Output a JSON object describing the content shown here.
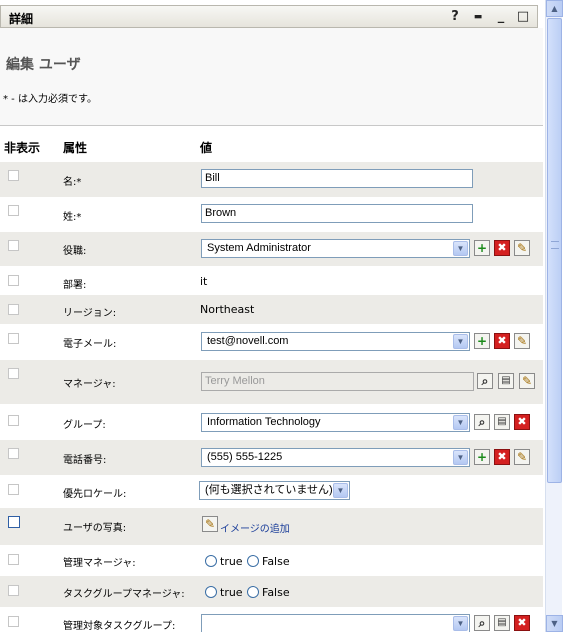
{
  "titlebar": {
    "title": "詳細",
    "help": "?",
    "print": "▬",
    "minimize": "_",
    "maximize": "□"
  },
  "page": {
    "heading": "編集 ユーザ",
    "required_note": "* - は入力必須です。"
  },
  "columns": {
    "hide": "非表示",
    "attribute": "属性",
    "value": "値"
  },
  "rows": [
    {
      "label": "名:*",
      "value": "Bill"
    },
    {
      "label": "姓:*",
      "value": "Brown"
    },
    {
      "label": "役職:",
      "value": "System Administrator"
    },
    {
      "label": "部署:",
      "value": "it"
    },
    {
      "label": "リージョン:",
      "value": "Northeast"
    },
    {
      "label": "電子メール:",
      "value": "test@novell.com"
    },
    {
      "label": "マネージャ:",
      "value": "Terry Mellon"
    },
    {
      "label": "グループ:",
      "value": "Information Technology"
    },
    {
      "label": "電話番号:",
      "value": "(555) 555-1225"
    },
    {
      "label": "優先ロケール:",
      "value": "(何も選択されていません)"
    },
    {
      "label": "ユーザの写真:",
      "value": "イメージの追加"
    },
    {
      "label": "管理マネージャ:",
      "true_label": "true",
      "false_label": "False"
    },
    {
      "label": "タスクグループマネージャ:",
      "true_label": "true",
      "false_label": "False"
    },
    {
      "label": "管理対象タスクグループ:",
      "value": ""
    }
  ],
  "icons": {
    "add": "+",
    "delete": "✖",
    "edit": "✎",
    "lookup": "⌕",
    "history": "▤",
    "select_arrow": "▼"
  }
}
